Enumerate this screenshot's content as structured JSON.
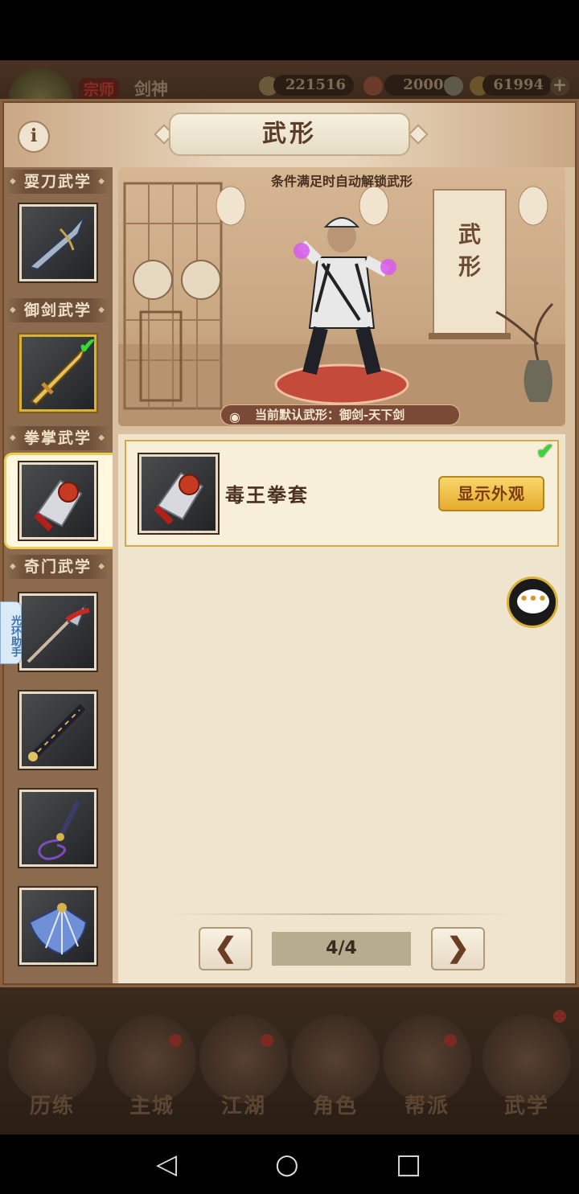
{
  "hud": {
    "rank": "宗师",
    "player_name": "剑神",
    "currency_1": "221516",
    "currency_2": "20000",
    "currency_3": "61994",
    "plus_symbol": "+"
  },
  "panel": {
    "title": "武形",
    "info_symbol": "i"
  },
  "sidebar": {
    "categories": [
      {
        "label": "耍刀武学"
      },
      {
        "label": "御剑武学"
      },
      {
        "label": "拳掌武学"
      },
      {
        "label": "奇门武学"
      }
    ],
    "items": [
      {
        "icon": "blade-weapon-icon",
        "equipped": false
      },
      {
        "icon": "golden-sword-icon",
        "equipped": true
      },
      {
        "icon": "fist-gauntlet-icon",
        "equipped": false,
        "selected": true
      },
      {
        "icon": "spear-icon",
        "equipped": false
      },
      {
        "icon": "flute-icon",
        "equipped": false
      },
      {
        "icon": "whip-dagger-icon",
        "equipped": false
      },
      {
        "icon": "fan-icon",
        "equipped": false
      }
    ]
  },
  "helper_tab": "光环助手",
  "stage": {
    "caption": "条件满足时自动解锁武形",
    "scroll_text": "武形",
    "default_form": "当前默认武形：御剑-天下剑"
  },
  "item": {
    "name": "毒王拳套",
    "show_button": "显示外观",
    "unlocked": true
  },
  "pager": {
    "prev": "❮",
    "next": "❯",
    "page": "4/4"
  },
  "bottom_nav": [
    {
      "label": "历练",
      "badge": false
    },
    {
      "label": "主城",
      "badge": true
    },
    {
      "label": "江湖",
      "badge": true
    },
    {
      "label": "角色",
      "badge": false
    },
    {
      "label": "帮派",
      "badge": true
    },
    {
      "label": "武学",
      "badge": true
    }
  ],
  "colors": {
    "accent_gold": "#d9b236",
    "check_green": "#3bd63b",
    "panel_brown": "#6b4a30"
  }
}
